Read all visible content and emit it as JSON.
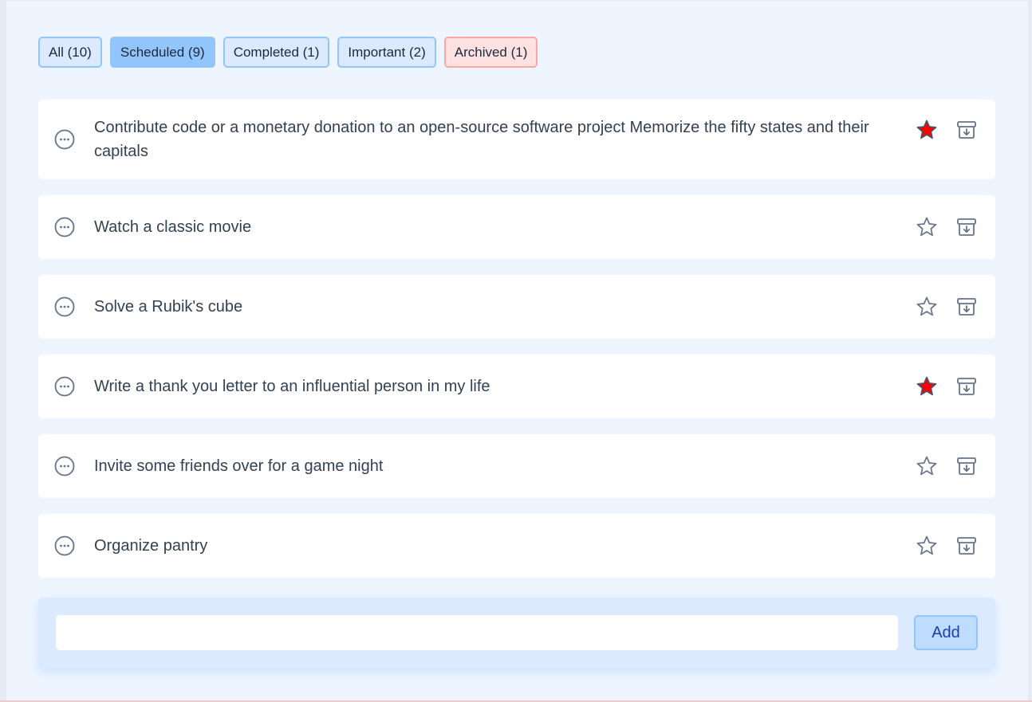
{
  "filters": [
    {
      "label": "All (10)"
    },
    {
      "label": "Scheduled (9)"
    },
    {
      "label": "Completed (1)"
    },
    {
      "label": "Important (2)"
    },
    {
      "label": "Archived (1)"
    }
  ],
  "active_filter": "Scheduled (9)",
  "tasks": [
    {
      "text": "Contribute code or a monetary donation to an open-source software project Memorize the fifty states and their capitals",
      "important": true
    },
    {
      "text": "Watch a classic movie",
      "important": false
    },
    {
      "text": "Solve a Rubik's cube",
      "important": false
    },
    {
      "text": "Write a thank you letter to an influential person in my life",
      "important": true
    },
    {
      "text": "Invite some friends over for a game night",
      "important": false
    },
    {
      "text": "Organize pantry",
      "important": false
    }
  ],
  "composer": {
    "input_value": "",
    "placeholder": "",
    "add_label": "Add"
  },
  "icons": {
    "more": "more-horizontal-circle-icon",
    "star": "star-icon",
    "archive": "archive-icon"
  },
  "colors": {
    "star_active": "#ff0000",
    "icon_stroke": "#64748b",
    "accent": "#93c5fd",
    "archived_tint": "#fca5a5"
  }
}
